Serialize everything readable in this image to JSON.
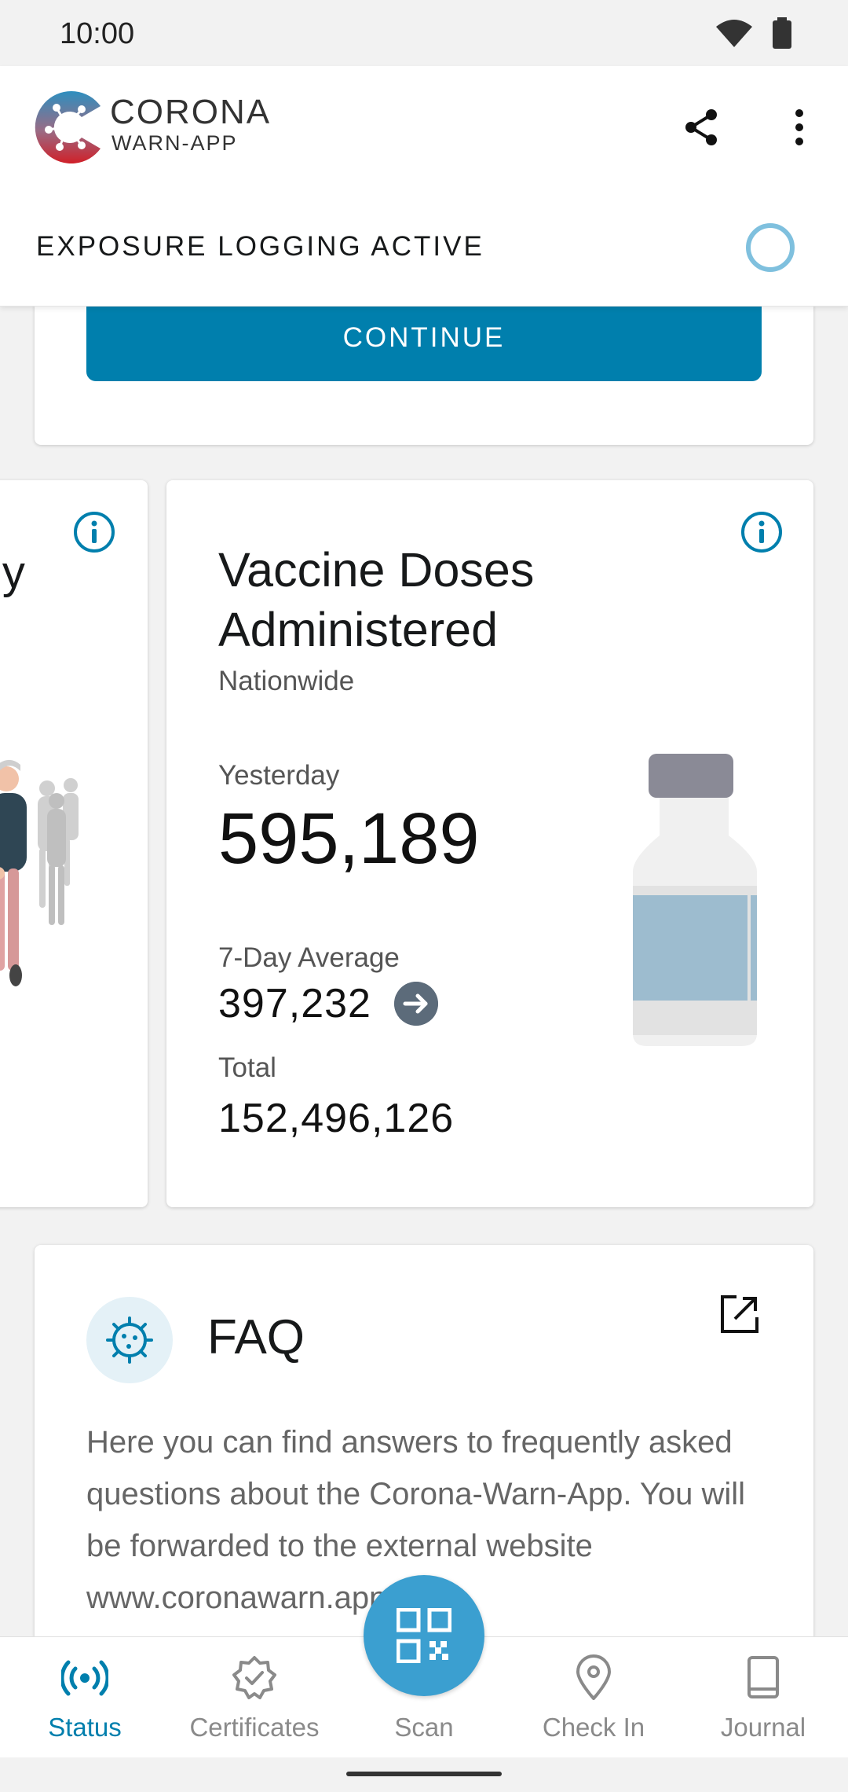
{
  "status_bar": {
    "time": "10:00"
  },
  "header": {
    "logo_title": "CORONA",
    "logo_subtitle": "WARN-APP",
    "share_icon": "share-icon",
    "menu_icon": "more-vert-icon"
  },
  "exposure": {
    "label": "EXPOSURE LOGGING ACTIVE"
  },
  "continue_card": {
    "button_label": "CONTINUE"
  },
  "left_card": {
    "title_fragment": "ly"
  },
  "vaccine_card": {
    "title": "Vaccine Doses Administered",
    "subtitle": "Nationwide",
    "yesterday_label": "Yesterday",
    "yesterday_value": "595,189",
    "avg_label": "7-Day Average",
    "avg_value": "397,232",
    "trend_icon": "arrow-right-icon",
    "total_label": "Total",
    "total_value": "152,496,126"
  },
  "faq_card": {
    "title": "FAQ",
    "text": "Here you can find answers to frequently asked questions about the Corona-Warn-App. You will be forwarded to the external website www.coronawarn.app."
  },
  "bottom_nav": {
    "items": [
      {
        "label": "Status",
        "icon": "status-icon",
        "active": true
      },
      {
        "label": "Certificates",
        "icon": "certificate-icon",
        "active": false
      },
      {
        "label": "Scan",
        "icon": "qr-code-icon",
        "active": false
      },
      {
        "label": "Check In",
        "icon": "location-pin-icon",
        "active": false
      },
      {
        "label": "Journal",
        "icon": "book-icon",
        "active": false
      }
    ]
  },
  "colors": {
    "accent": "#007fad",
    "fab": "#3b9fd0",
    "exposure_ring": "#7fc0de"
  }
}
